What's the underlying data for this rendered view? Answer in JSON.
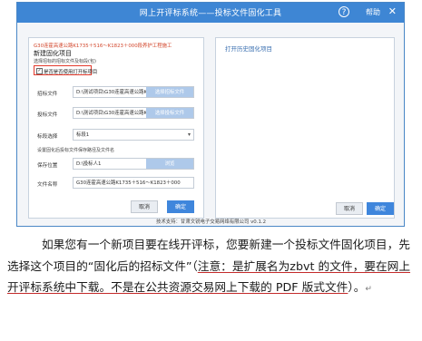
{
  "window": {
    "title": "网上开评标系统——投标文件固化工具",
    "help_icon_glyph": "?",
    "help_label": "帮助",
    "close_glyph": "✕"
  },
  "left_panel": {
    "project_name": "G30连霍高速公路K1735＋516～K1823＋000段养护工程施工",
    "new_project_title": "新建固化项目",
    "select_hint": "选择招标的招标文件及标段(包)",
    "checkbox_label": "是否是否使用打开标项目",
    "checkbox_checked": true,
    "bid_file_label": "招标文件",
    "bid_file_value": "D:\\测试项目\\G30连霍高速公路K173",
    "bid_file_button": "选择招标文件",
    "tender_file_label": "投标文件",
    "tender_file_value": "D:\\测试项目\\G30连霍高速公路K173",
    "tender_file_button": "选择投标文件",
    "section_label": "标段选择",
    "section_value": "标段1",
    "section_caret": "▾",
    "save_hint": "设置固化后投标文件保存路径及文件名",
    "save_location_label": "保存位置",
    "save_location_value": "D:\\投标人1",
    "browse_button": "浏览",
    "filename_label": "文件名称",
    "filename_value": "G30连霍高速公路K1735＋516～K1823＋000",
    "cancel_button": "取消",
    "ok_button": "确定"
  },
  "right_panel": {
    "title": "打开历史固化项目",
    "cancel_button": "取消",
    "ok_button": "确定"
  },
  "support_text": "技术支持：甘肃文锐电子交易网络有限公司 v0.1.2",
  "paragraph": {
    "part1": "如果您有一个新项目要在线开评标，您要新建一个投标文件固化项目，先选择这个项目的“固化后的招标文件”（",
    "underlined": "注意：是扩展名为zbvt 的文件，要在网上开评标系统中下载。不是在公共资源交易网上下载的 PDF 版式文件",
    "part2": "）。",
    "pilcrow": "↵"
  },
  "colors": {
    "titlebar": "#3e86d4",
    "accent_blue": "#3f86dc",
    "warning_red": "#d2462b",
    "highlight_border": "#e43b2d"
  }
}
